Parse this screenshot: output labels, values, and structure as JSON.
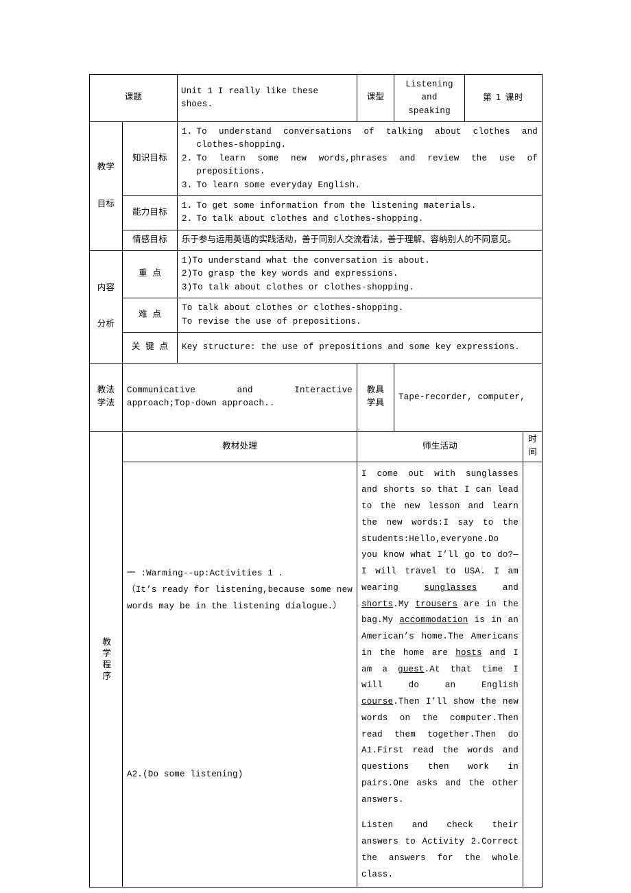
{
  "document": {
    "title_label": "课题",
    "title_value": "Unit 1 I really like these shoes.",
    "type_label": "课型",
    "type_value": "Listening and speaking",
    "period_value": "第 1 课时",
    "teaching_goal_label_1": "教学",
    "teaching_goal_label_2": "目标",
    "knowledge_goal_label": "知识目标",
    "knowledge_goals": [
      {
        "num": "1.",
        "text": "To understand conversations of talking about clothes and clothes-shopping."
      },
      {
        "num": "2.",
        "text": "To learn some new words,phrases and review the use of prepositions."
      },
      {
        "num": "3.",
        "text": "To learn some everyday English."
      }
    ],
    "ability_goal_label": "能力目标",
    "ability_goals": [
      {
        "num": "1.",
        "text": "To get some information from the listening materials."
      },
      {
        "num": "2.",
        "text": "To talk about clothes and clothes-shopping."
      }
    ],
    "emotion_goal_label": "情感目标",
    "emotion_goal_text": "乐于参与运用英语的实践活动，善于同别人交流看法，善于理解、容纳别人的不同意见。",
    "content_label_1": "内容",
    "content_label_2": "分析",
    "key_point_label": "重  点",
    "key_points": [
      "1)To understand what the conversation is about.",
      "2)To grasp the key words and expressions.",
      "3)To talk about clothes or clothes-shopping."
    ],
    "difficult_point_label": "难  点",
    "difficult_points": [
      " To talk about clothes or clothes-shopping.",
      "To revise the use of prepositions."
    ],
    "crucial_point_label": "关 键 点",
    "crucial_point_text": "Key structure: the use of prepositions and some key expressions.",
    "method_label_1": "教法",
    "method_label_2": "学法",
    "method_text": "Communicative and Interactive approach;Top-down approach..",
    "aids_label_1": "教具",
    "aids_label_2": "学具",
    "aids_text": "Tape-recorder, computer,",
    "procedure_label": "教学程序",
    "col_material": "教材处理",
    "col_activity": "师生活动",
    "col_time_1": "时",
    "col_time_2": "间",
    "material_blocks": [
      "一 :Warming--up:Activities 1 .",
      "（It’s  ready  for listening,because  some  new words may be in the listening dialogue.）"
    ],
    "material_block_2": "A2.(Do some listening)",
    "activity_text": "I come out with sunglasses and shorts so that I can lead to the new lesson and learn the new words:I say to the students:Hello,everyone.Do you know what I’ll go to do?—I will travel to USA. I am wearing sunglasses and shorts.My trousers are in the bag.My accommodation is in an American’s home.The Americans in the home are hosts and I am a guest.At that time I will do an English course.Then I’ll show the new words on the computer.Then read them together.Then do A1.First read the words and questions then work in pairs.One asks and the other answers.",
    "activity_text_2": "Listen and check their answers to Activity 2.Correct the answers for the whole class."
  }
}
